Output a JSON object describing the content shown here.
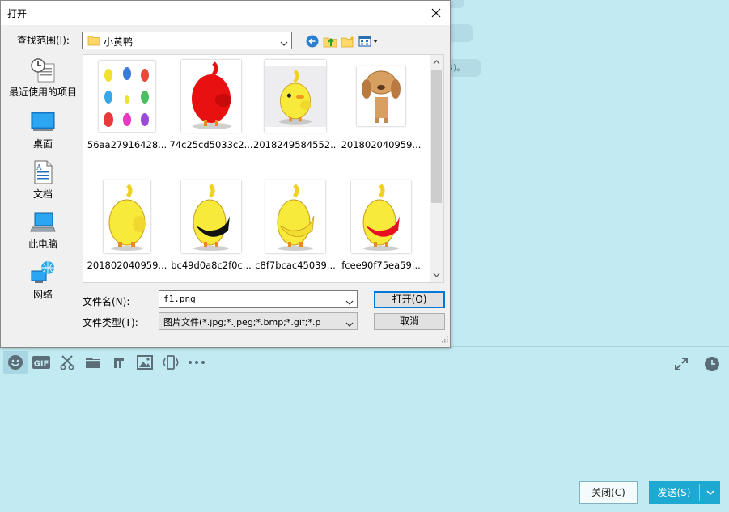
{
  "background": {
    "bubble_1": "",
    "bubble_2": "。",
    "bubble_3": "(B)。"
  },
  "dialog": {
    "title": "打开",
    "look_in_label": "查找范围(I):",
    "look_in_value": "小黄鸭",
    "places": [
      {
        "label": "最近使用的项目",
        "icon": "recent-items-icon"
      },
      {
        "label": "桌面",
        "icon": "desktop-icon"
      },
      {
        "label": "文档",
        "icon": "documents-icon"
      },
      {
        "label": "此电脑",
        "icon": "this-pc-icon"
      },
      {
        "label": "网络",
        "icon": "network-icon"
      }
    ],
    "files": [
      {
        "name": "56aa27916428..."
      },
      {
        "name": "74c25cd5033c2..."
      },
      {
        "name": "2018249584552..."
      },
      {
        "name": "201802040959..."
      },
      {
        "name": "201802040959..."
      },
      {
        "name": "bc49d0a8c2f0c..."
      },
      {
        "name": "c8f7bcac45039..."
      },
      {
        "name": "fcee90f75ea59..."
      }
    ],
    "filename_label": "文件名(N):",
    "filename_value": "f1.png",
    "filetype_label": "文件类型(T):",
    "filetype_value": "图片文件(*.jpg;*.jpeg;*.bmp;*.gif;*.p",
    "open_button": "打开(O)",
    "cancel_button": "取消"
  },
  "chat": {
    "toolbar_icons": [
      "emoji-icon",
      "gif-icon",
      "scissors-icon",
      "folder-icon",
      "music-icon",
      "image-icon",
      "shake-icon",
      "more-icon"
    ],
    "right_icons": [
      "expand-icon",
      "history-clock-icon"
    ],
    "close_button": "关闭(C)",
    "send_button": "发送(S)"
  },
  "colors": {
    "chat_background": "#c2eaf2",
    "send_button": "#1ea9d2",
    "dialog_background": "#f0f0f0",
    "primary_border": "#0078d7"
  }
}
